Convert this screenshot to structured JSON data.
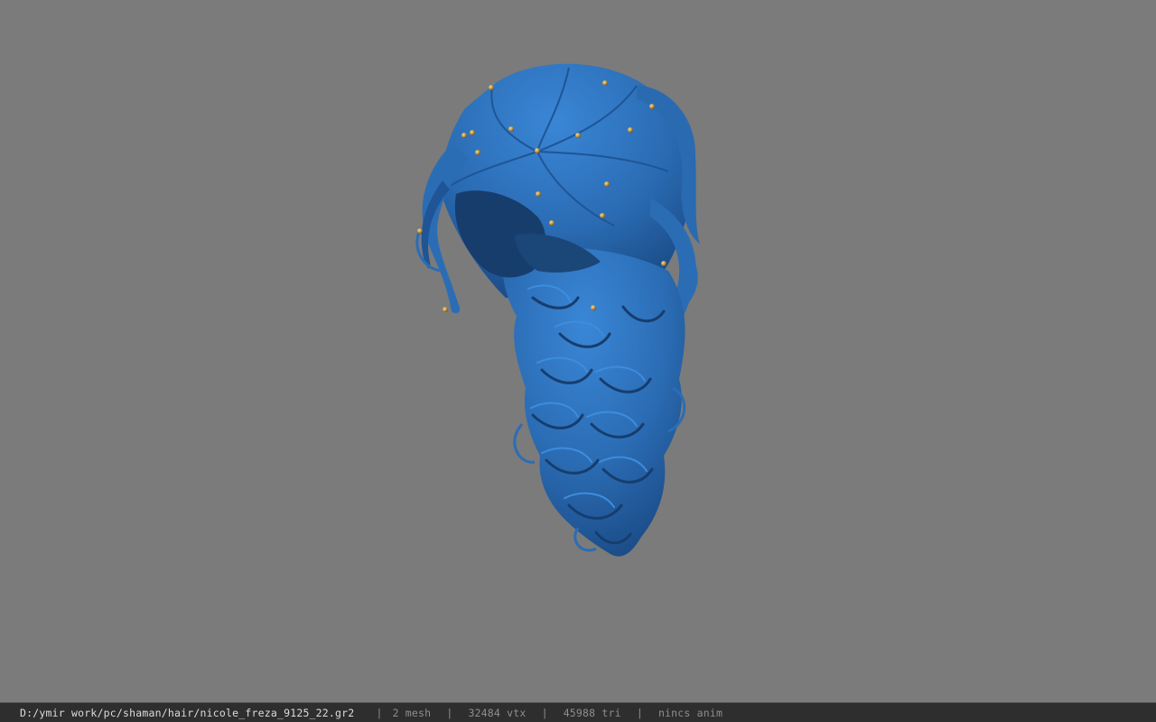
{
  "viewer": {
    "background_color": "#7b7b7b",
    "model_color": "#2f74c0",
    "model_dark_color": "#163a66",
    "bone_marker_color": "#c8a04a",
    "model_name": "hair mesh"
  },
  "status_bar": {
    "file_path": "D:/ymir work/pc/shaman/hair/nicole_freza_9125_22.gr2",
    "separator": "|",
    "mesh_count": "2 mesh",
    "vertex_count": "32484 vtx",
    "triangle_count": "45988 tri",
    "anim_status": "nincs anim"
  }
}
